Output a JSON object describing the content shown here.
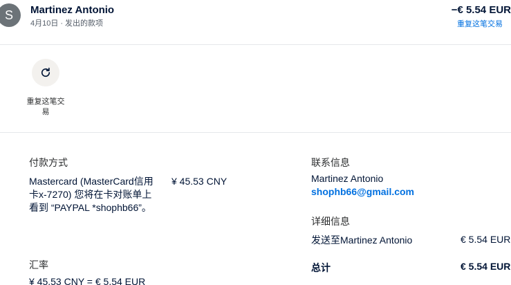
{
  "header": {
    "avatar_letter": "S",
    "merchant_name": "Martinez Antonio",
    "date": "4月10日",
    "separator": "·",
    "transaction_type": "发出的款项",
    "amount": "−€ 5.54 EUR",
    "repeat_link": "重复这笔交易"
  },
  "actions": {
    "repeat_icon": "refresh-icon",
    "repeat_label": "重复这笔交易"
  },
  "payment": {
    "title": "付款方式",
    "method_description": "Mastercard (MasterCard信用卡x-7270) 您将在卡对账单上看到 “PAYPAL *shophb66”。",
    "amount": "¥ 45.53 CNY"
  },
  "exchange": {
    "title": "汇率",
    "rate": "¥ 45.53 CNY = € 5.54 EUR"
  },
  "contact": {
    "title": "联系信息",
    "name": "Martinez Antonio",
    "email": "shophb66@gmail.com"
  },
  "details": {
    "title": "详细信息",
    "sent_to_label": "发送至Martinez Antonio",
    "sent_to_amount": "€ 5.54 EUR",
    "total_label": "总计",
    "total_amount": "€ 5.54 EUR"
  },
  "colors": {
    "link": "#0070e0",
    "avatar_bg": "#6c7378",
    "action_bg": "#f3f1ee",
    "text_dark": "#001435"
  }
}
